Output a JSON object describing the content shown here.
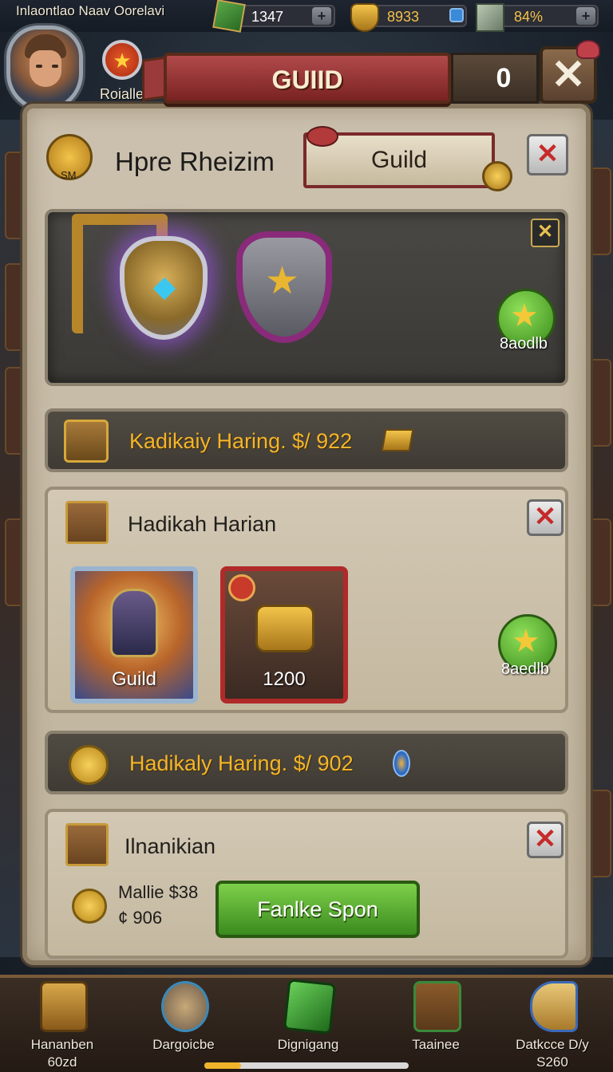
{
  "top_bar": {
    "player_name": "Inlaontlao Naav Oorelavi",
    "resources": [
      {
        "icon": "gem-cube-icon",
        "value": "1347"
      },
      {
        "icon": "gold-crest-icon",
        "value": "8933"
      },
      {
        "icon": "stone-cube-icon",
        "value": "84%"
      }
    ]
  },
  "profile": {
    "rank_label": "Roialle"
  },
  "window": {
    "title": "GUIID",
    "counter": "0"
  },
  "header": {
    "icon_label": "SM",
    "title": "Hpre Rheizim",
    "tab_label": "Guild"
  },
  "featured_slot": {
    "badge_label": "8aodlb"
  },
  "reward_bar_1": {
    "text": "Kadikaiy Haring. $/ 922"
  },
  "section_1": {
    "title": "Hadikah Harian",
    "cards": [
      {
        "label": "Guild"
      },
      {
        "label": "1200"
      }
    ],
    "badge_label": "8aedlb"
  },
  "reward_bar_2": {
    "text": "Hadikaly Haring. $/ 902"
  },
  "section_2": {
    "title": "Ilnanikian",
    "price_line1": "Mallie $38",
    "price_line2": "¢ 906",
    "button_label": "Fanlke Spon"
  },
  "bottom_nav": [
    {
      "icon": "scroll-chest-icon",
      "label": "Hananben",
      "sub": "60zd"
    },
    {
      "icon": "shield-orb-icon",
      "label": "Dargoicbe",
      "sub": ""
    },
    {
      "icon": "emerald-crystal-icon",
      "label": "Dignigang",
      "sub": ""
    },
    {
      "icon": "treasure-box-icon",
      "label": "Taainee",
      "sub": ""
    },
    {
      "icon": "cannon-icon",
      "label": "Datkcce D/y",
      "sub": "S260"
    }
  ],
  "page_progress": 0.18,
  "colors": {
    "accent_gold": "#f4b52a",
    "title_red": "#9a2e2e",
    "action_green": "#5cb032"
  }
}
